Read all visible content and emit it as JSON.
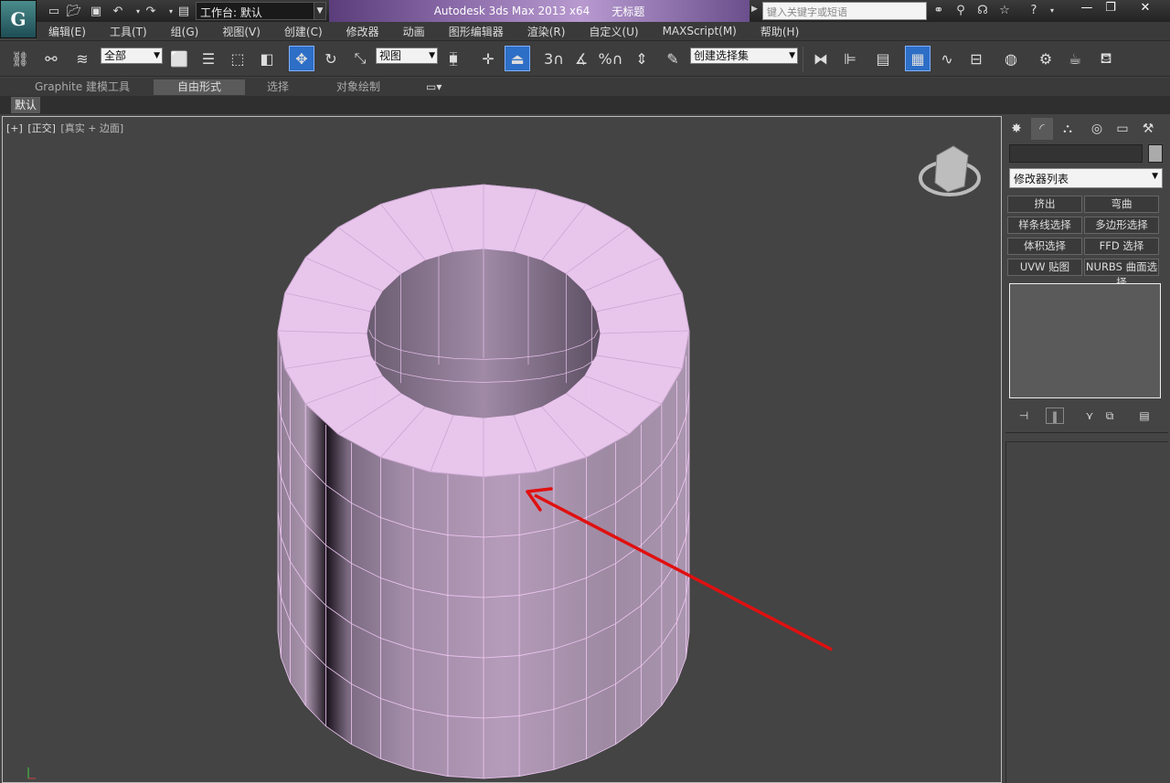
{
  "app": {
    "logo_text": "G",
    "workspace": "工作台: 默认",
    "title": "Autodesk 3ds Max  2013 x64",
    "document": "无标题",
    "search_placeholder": "键入关键字或短语"
  },
  "menu": [
    "编辑(E)",
    "工具(T)",
    "组(G)",
    "视图(V)",
    "创建(C)",
    "修改器",
    "动画",
    "图形编辑器",
    "渲染(R)",
    "自定义(U)",
    "MAXScript(M)",
    "帮助(H)"
  ],
  "toolbar": {
    "selection_filter": "全部",
    "ref_coord": "视图",
    "named_selection": "创建选择集",
    "snap_label": "3",
    "percent_label": "%"
  },
  "ribbon": {
    "tabs": [
      "Graphite 建模工具",
      "自由形式",
      "选择",
      "对象绘制"
    ],
    "active_index": 1,
    "sub_tab": "默认"
  },
  "viewport": {
    "label_plus": "[+]",
    "label_view": "[正交]",
    "label_shading": "[真实 + 边面]",
    "object_color": "#e8c6ec",
    "arrow_color": "#e01010"
  },
  "command_panel": {
    "modifier_list": "修改器列表",
    "buttons": [
      [
        "挤出",
        "弯曲"
      ],
      [
        "样条线选择",
        "多边形选择"
      ],
      [
        "体积选择",
        "FFD 选择"
      ],
      [
        "UVW 贴图",
        "NURBS 曲面选择"
      ]
    ]
  }
}
